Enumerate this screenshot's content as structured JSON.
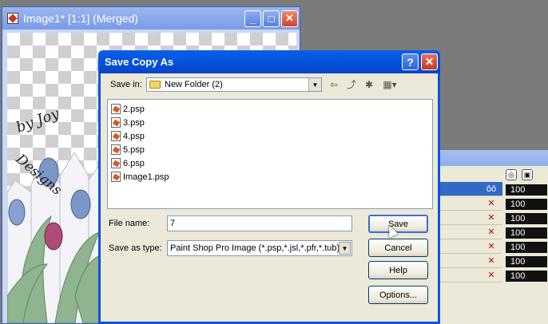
{
  "image_window": {
    "title": "Image1* [1:1] (Merged)",
    "buttons": {
      "minimize": "_",
      "maximize": "□",
      "close": "✕"
    },
    "canvas_text": {
      "line1": "by Joy",
      "line2": "Designs"
    }
  },
  "dialog": {
    "title": "Save Copy As",
    "help_btn": "?",
    "close_btn": "✕",
    "save_in_label": "Save in:",
    "save_in_value": "New Folder (2)",
    "files": [
      "2.psp",
      "3.psp",
      "4.psp",
      "5.psp",
      "6.psp",
      "Image1.psp"
    ],
    "file_name_label": "File name:",
    "file_name_value": "7",
    "save_as_type_label": "Save as type:",
    "save_as_type_value": "Paint Shop Pro Image (*.psp,*.jsl,*.pfr,*.tub)",
    "buttons": {
      "save": "Save",
      "cancel": "Cancel",
      "help": "Help",
      "options": "Options..."
    }
  },
  "layers_palette": {
    "opacities": [
      "100",
      "100",
      "100",
      "100",
      "100",
      "100",
      "100"
    ]
  },
  "colors": {
    "dialog_title": "#0650d8",
    "face": "#ece9d8",
    "selection": "#316ac5"
  }
}
